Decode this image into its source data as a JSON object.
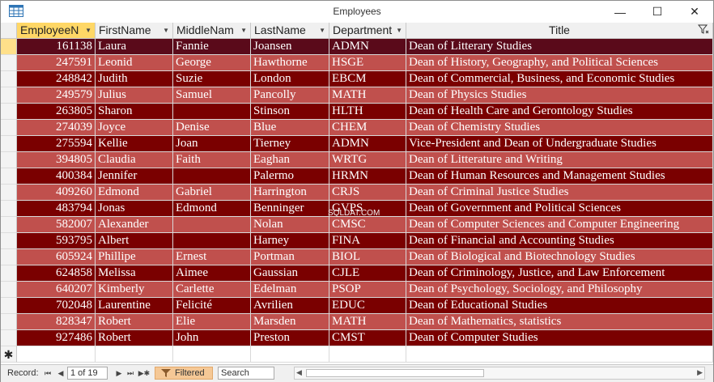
{
  "window": {
    "title": "Employees",
    "minimize": "—",
    "maximize": "☐",
    "close": "✕"
  },
  "colors": {
    "row_dark": "#7a0000",
    "row_light": "#c0504d",
    "row_selected": "#5a0a1a",
    "header_active": "#ffd766"
  },
  "columns": [
    {
      "key": "emp",
      "label": "EmployeeN"
    },
    {
      "key": "first",
      "label": "FirstName"
    },
    {
      "key": "middle",
      "label": "MiddleNam"
    },
    {
      "key": "last",
      "label": "LastName"
    },
    {
      "key": "dept",
      "label": "Department"
    },
    {
      "key": "title",
      "label": "Title"
    }
  ],
  "rows": [
    {
      "emp": "161138",
      "first": "Laura",
      "middle": "Fannie",
      "last": "Joansen",
      "dept": "ADMN",
      "title": "Dean of Litterary Studies"
    },
    {
      "emp": "247591",
      "first": "Leonid",
      "middle": "George",
      "last": "Hawthorne",
      "dept": "HSGE",
      "title": "Dean of History, Geography, and Political Sciences"
    },
    {
      "emp": "248842",
      "first": "Judith",
      "middle": "Suzie",
      "last": "London",
      "dept": "EBCM",
      "title": "Dean of Commercial, Business, and Economic Studies"
    },
    {
      "emp": "249579",
      "first": "Julius",
      "middle": "Samuel",
      "last": "Pancolly",
      "dept": "MATH",
      "title": "Dean of Physics Studies"
    },
    {
      "emp": "263805",
      "first": "Sharon",
      "middle": "",
      "last": "Stinson",
      "dept": "HLTH",
      "title": "Dean of Health Care and Gerontology Studies"
    },
    {
      "emp": "274039",
      "first": "Joyce",
      "middle": "Denise",
      "last": "Blue",
      "dept": "CHEM",
      "title": "Dean of Chemistry Studies"
    },
    {
      "emp": "275594",
      "first": "Kellie",
      "middle": "Joan",
      "last": "Tierney",
      "dept": "ADMN",
      "title": "Vice-President and Dean of Undergraduate Studies"
    },
    {
      "emp": "394805",
      "first": "Claudia",
      "middle": "Faith",
      "last": "Eaghan",
      "dept": "WRTG",
      "title": "Dean of Litterature and Writing"
    },
    {
      "emp": "400384",
      "first": "Jennifer",
      "middle": "",
      "last": "Palermo",
      "dept": "HRMN",
      "title": "Dean of Human Resources and Management Studies"
    },
    {
      "emp": "409260",
      "first": "Edmond",
      "middle": "Gabriel",
      "last": "Harrington",
      "dept": "CRJS",
      "title": "Dean of Criminal Justice Studies"
    },
    {
      "emp": "483794",
      "first": "Jonas",
      "middle": "Edmond",
      "last": "Benninger",
      "dept": "GVPS",
      "title": "Dean of Government and Political Sciences"
    },
    {
      "emp": "582007",
      "first": "Alexander",
      "middle": "",
      "last": "Nolan",
      "dept": "CMSC",
      "title": "Dean of Computer Sciences and Computer Engineering"
    },
    {
      "emp": "593795",
      "first": "Albert",
      "middle": "",
      "last": "Harney",
      "dept": "FINA",
      "title": "Dean of Financial and Accounting Studies"
    },
    {
      "emp": "605924",
      "first": "Phillipe",
      "middle": "Ernest",
      "last": "Portman",
      "dept": "BIOL",
      "title": "Dean of Biological and Biotechnology Studies"
    },
    {
      "emp": "624858",
      "first": "Melissa",
      "middle": "Aimee",
      "last": "Gaussian",
      "dept": "CJLE",
      "title": "Dean of Criminology, Justice, and Law Enforcement"
    },
    {
      "emp": "640207",
      "first": "Kimberly",
      "middle": "Carlette",
      "last": "Edelman",
      "dept": "PSOP",
      "title": "Dean of Psychology, Sociology, and Philosophy"
    },
    {
      "emp": "702048",
      "first": "Laurentine",
      "middle": "Felicité",
      "last": "Avrilien",
      "dept": "EDUC",
      "title": "Dean of Educational Studies"
    },
    {
      "emp": "828347",
      "first": "Robert",
      "middle": "Elie",
      "last": "Marsden",
      "dept": "MATH",
      "title": "Dean of Mathematics, statistics"
    },
    {
      "emp": "927486",
      "first": "Robert",
      "middle": "John",
      "last": "Preston",
      "dept": "CMST",
      "title": "Dean of Computer Studies"
    }
  ],
  "new_record_marker": "✱",
  "watermark": "SQLDAT.COM",
  "statusbar": {
    "record_label": "Record:",
    "first": "⏮",
    "prev": "◀",
    "position": "1 of 19",
    "next": "▶",
    "last": "⏭",
    "new": "▶✱",
    "filter_label": "Filtered",
    "search_placeholder": "Search",
    "scroll_left": "◀",
    "scroll_right": "▶"
  }
}
